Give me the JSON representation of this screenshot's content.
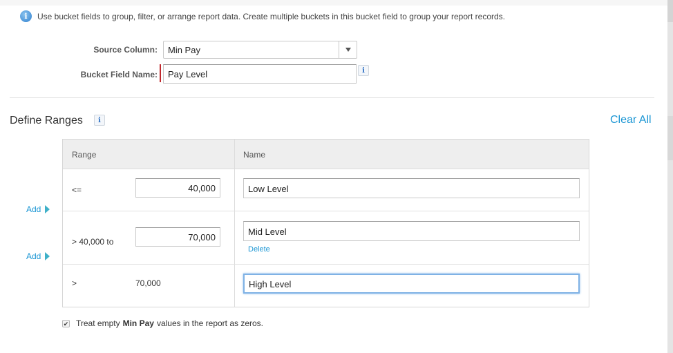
{
  "info_message": "Use bucket fields to group, filter, or arrange report data. Create multiple buckets in this bucket field to group your report records.",
  "form": {
    "source_column_label": "Source Column:",
    "source_column_value": "Min Pay",
    "bucket_field_label": "Bucket Field Name:",
    "bucket_field_value": "Pay Level",
    "bucket_field_required": true
  },
  "define_ranges": {
    "title": "Define Ranges",
    "clear_all_label": "Clear All",
    "add_label": "Add",
    "columns": [
      "Range",
      "Name"
    ],
    "rows": [
      {
        "operator": "<=",
        "range_value": "40,000",
        "range_editable": true,
        "name": "Low Level",
        "delete_label": ""
      },
      {
        "operator": "> 40,000 to",
        "range_value": "70,000",
        "range_editable": true,
        "name": "Mid Level",
        "delete_label": "Delete"
      },
      {
        "operator": ">",
        "range_value": "70,000",
        "range_editable": false,
        "name": "High Level",
        "delete_label": "",
        "focused": true
      }
    ]
  },
  "treat_empty": {
    "checked": true,
    "prefix": "Treat empty",
    "field": "Min Pay",
    "suffix": "values in the report as zeros."
  },
  "icons": {
    "info": "i",
    "checkmark": "✔"
  },
  "colors": {
    "link": "#1b96d4",
    "required": "#c0282d",
    "focus": "#7fb2e5"
  }
}
